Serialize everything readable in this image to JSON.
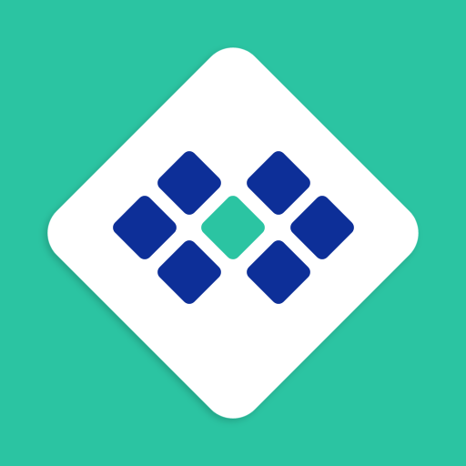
{
  "colors": {
    "background": "#2bc4a2",
    "diamond": "#ffffff",
    "tile_primary": "#0d2f98",
    "tile_center": "#2bc4a2",
    "shadow": "#000000"
  },
  "icon": {
    "name": "tile-grid-app-icon"
  }
}
